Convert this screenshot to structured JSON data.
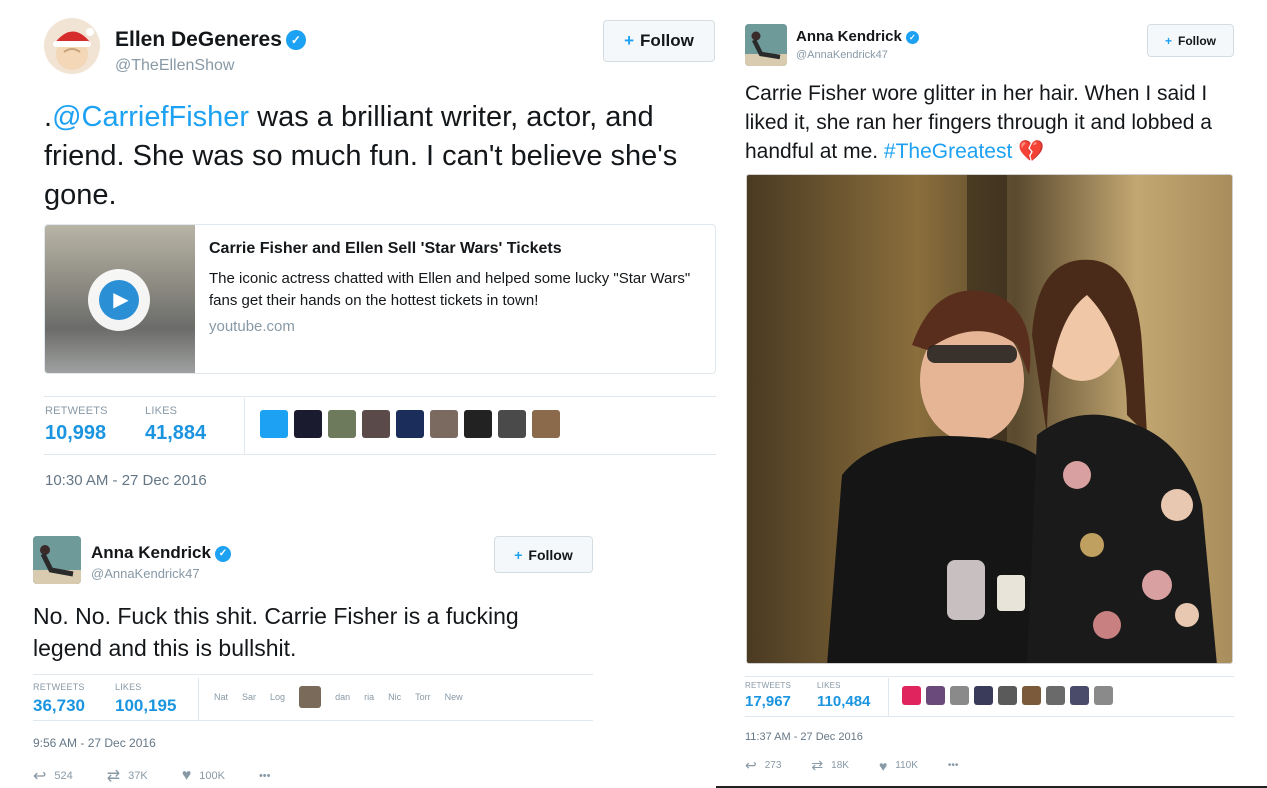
{
  "tweet_ellen": {
    "name": "Ellen DeGeneres",
    "handle": "@TheEllenShow",
    "follow_label": "Follow",
    "text_prefix": ".",
    "mention": "@CarriefFisher",
    "text_rest": " was a brilliant writer, actor, and friend. She was so much fun. I can't believe she's gone.",
    "card": {
      "title": "Carrie Fisher and Ellen Sell 'Star Wars' Tickets",
      "description": "The iconic actress chatted with Ellen and helped some lucky \"Star Wars\" fans get their hands on the hottest tickets in town!",
      "domain": "youtube.com"
    },
    "retweets_label": "RETWEETS",
    "retweets": "10,998",
    "likes_label": "LIKES",
    "likes": "41,884",
    "timestamp": "10:30 AM - 27 Dec 2016",
    "facepile_colors": [
      "#1da1f2",
      "#1b1b2f",
      "#6d7a5c",
      "#5a4a4a",
      "#1b2d5a",
      "#7a6a60",
      "#222222",
      "#4a4a4a",
      "#8a6a4a"
    ]
  },
  "tweet_anna_text": {
    "name": "Anna Kendrick",
    "handle": "@AnnaKendrick47",
    "follow_label": "Follow",
    "text": "No. No. Fuck this shit. Carrie Fisher is a fucking legend and this is bullshit.",
    "retweets_label": "RETWEETS",
    "retweets": "36,730",
    "likes_label": "LIKES",
    "likes": "100,195",
    "liker_names": [
      "Nat",
      "Sar",
      "Log",
      "dan",
      "ria",
      "Nic",
      "Torr",
      "New"
    ],
    "timestamp": "9:56 AM - 27 Dec 2016",
    "actions": {
      "reply": "524",
      "retweet": "37K",
      "like": "100K"
    }
  },
  "tweet_anna_photo": {
    "name": "Anna Kendrick",
    "handle": "@AnnaKendrick47",
    "follow_label": "Follow",
    "text": "Carrie Fisher wore glitter in her hair. When I said I liked it, she ran her fingers through it and lobbed a handful at me. ",
    "hashtag": "#TheGreatest",
    "emoji": "💔",
    "retweets_label": "RETWEETS",
    "retweets": "17,967",
    "likes_label": "LIKES",
    "likes": "110,484",
    "timestamp": "11:37 AM - 27 Dec 2016",
    "facepile_colors": [
      "#e0245e",
      "#6a4a7a",
      "#8a8a8a",
      "#3a3a5a",
      "#5a5a5a",
      "#7a5a3a",
      "#6a6a6a",
      "#4a4a6a",
      "#8a8a8a"
    ],
    "actions": {
      "reply": "273",
      "retweet": "18K",
      "like": "110K"
    }
  },
  "icons": {
    "verified": "✓",
    "follow": "+",
    "play": "▶",
    "reply": "↩",
    "retweet": "⇄",
    "like": "♥",
    "more": "•••"
  }
}
